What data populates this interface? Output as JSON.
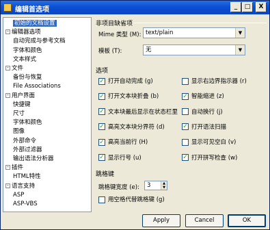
{
  "window": {
    "title": "编辑首选项",
    "min_glyph": "_",
    "max_glyph": "□",
    "close_glyph": "X"
  },
  "tree": {
    "items": [
      {
        "label": "初始的文档设置",
        "level": 0,
        "expander": "",
        "selected": true
      },
      {
        "label": "编辑器选项",
        "level": 0,
        "expander": "-"
      },
      {
        "label": "自动完成与参考文档",
        "level": 1,
        "expander": ""
      },
      {
        "label": "字体和颜色",
        "level": 1,
        "expander": ""
      },
      {
        "label": "文本样式",
        "level": 1,
        "expander": ""
      },
      {
        "label": "文件",
        "level": 0,
        "expander": "-"
      },
      {
        "label": "备份与恢复",
        "level": 1,
        "expander": ""
      },
      {
        "label": "File Associations",
        "level": 1,
        "expander": ""
      },
      {
        "label": "用户界面",
        "level": 0,
        "expander": "-"
      },
      {
        "label": "快捷键",
        "level": 1,
        "expander": ""
      },
      {
        "label": "尺寸",
        "level": 1,
        "expander": ""
      },
      {
        "label": "字体和颜色",
        "level": 1,
        "expander": ""
      },
      {
        "label": "图像",
        "level": 0,
        "expander": ""
      },
      {
        "label": "外部命令",
        "level": 0,
        "expander": ""
      },
      {
        "label": "外部过滤器",
        "level": 0,
        "expander": ""
      },
      {
        "label": "输出语法分析器",
        "level": 0,
        "expander": ""
      },
      {
        "label": "插件",
        "level": 0,
        "expander": "-"
      },
      {
        "label": "HTML特性",
        "level": 1,
        "expander": ""
      },
      {
        "label": "语言支持",
        "level": 0,
        "expander": "-"
      },
      {
        "label": "ASP",
        "level": 1,
        "expander": ""
      },
      {
        "label": "ASP-VBS",
        "level": 1,
        "expander": ""
      }
    ]
  },
  "nondefault": {
    "group_title": "非项目缺省项",
    "mime_label": "Mime 类型 (M):",
    "mime_value": "text/plain",
    "template_label": "模板 (T):",
    "template_value": "无"
  },
  "options": {
    "group_title": "选项",
    "checkboxes": [
      {
        "label": "打开自动完成 (g)",
        "checked": true
      },
      {
        "label": "显示右边界指示器 (r)",
        "checked": false
      },
      {
        "label": "打开文本块折叠 (b)",
        "checked": true
      },
      {
        "label": "智能缩进 (z)",
        "checked": true
      },
      {
        "label": "文本块最后显示在状态栏里",
        "checked": true
      },
      {
        "label": "自动换行 (j)",
        "checked": false
      },
      {
        "label": "高亮文本块分界符 (d)",
        "checked": true
      },
      {
        "label": "打开语法扫描",
        "checked": true
      },
      {
        "label": "高亮当前行 (H)",
        "checked": true
      },
      {
        "label": "显示可见空白 (v)",
        "checked": false
      },
      {
        "label": "显示行号 (u)",
        "checked": true
      },
      {
        "label": "打开拼写检查 (w)",
        "checked": true
      }
    ]
  },
  "tabs": {
    "group_title": "跳格键",
    "width_label": "跳格键宽度 (e):",
    "width_value": "3",
    "spaces_label": "用空格代替跳格键 (g)",
    "spaces_checked": false
  },
  "buttons": {
    "apply": "Apply",
    "cancel": "Cancel",
    "ok": "OK"
  },
  "colors": {
    "titlebar": "#0b4fd3",
    "selection": "#316ac5",
    "check": "#21a121"
  }
}
